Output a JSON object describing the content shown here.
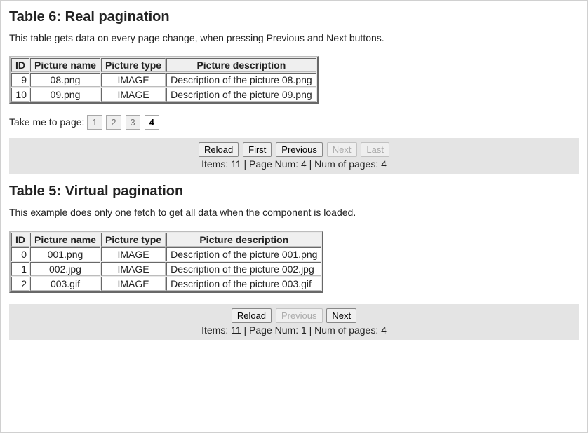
{
  "section1": {
    "heading": "Table 6: Real pagination",
    "desc": "This table gets data on every page change, when pressing Previous and Next buttons.",
    "columns": [
      "ID",
      "Picture name",
      "Picture type",
      "Picture description"
    ],
    "rows": [
      {
        "id": "9",
        "name": "08.png",
        "type": "IMAGE",
        "desc": "Description of the picture 08.png"
      },
      {
        "id": "10",
        "name": "09.png",
        "type": "IMAGE",
        "desc": "Description of the picture 09.png"
      }
    ],
    "pager_label": "Take me to page:",
    "pages": [
      "1",
      "2",
      "3",
      "4"
    ],
    "current_page": "4",
    "buttons": {
      "reload": "Reload",
      "first": "First",
      "previous": "Previous",
      "next": "Next",
      "last": "Last"
    },
    "status": "Items: 11 | Page Num: 4 | Num of pages: 4"
  },
  "section2": {
    "heading": "Table 5: Virtual pagination",
    "desc": "This example does only one fetch to get all data when the component is loaded.",
    "columns": [
      "ID",
      "Picture name",
      "Picture type",
      "Picture description"
    ],
    "rows": [
      {
        "id": "0",
        "name": "001.png",
        "type": "IMAGE",
        "desc": "Description of the picture 001.png"
      },
      {
        "id": "1",
        "name": "002.jpg",
        "type": "IMAGE",
        "desc": "Description of the picture 002.jpg"
      },
      {
        "id": "2",
        "name": "003.gif",
        "type": "IMAGE",
        "desc": "Description of the picture 003.gif"
      }
    ],
    "buttons": {
      "reload": "Reload",
      "previous": "Previous",
      "next": "Next"
    },
    "status": "Items: 11 | Page Num: 1 | Num of pages: 4"
  }
}
